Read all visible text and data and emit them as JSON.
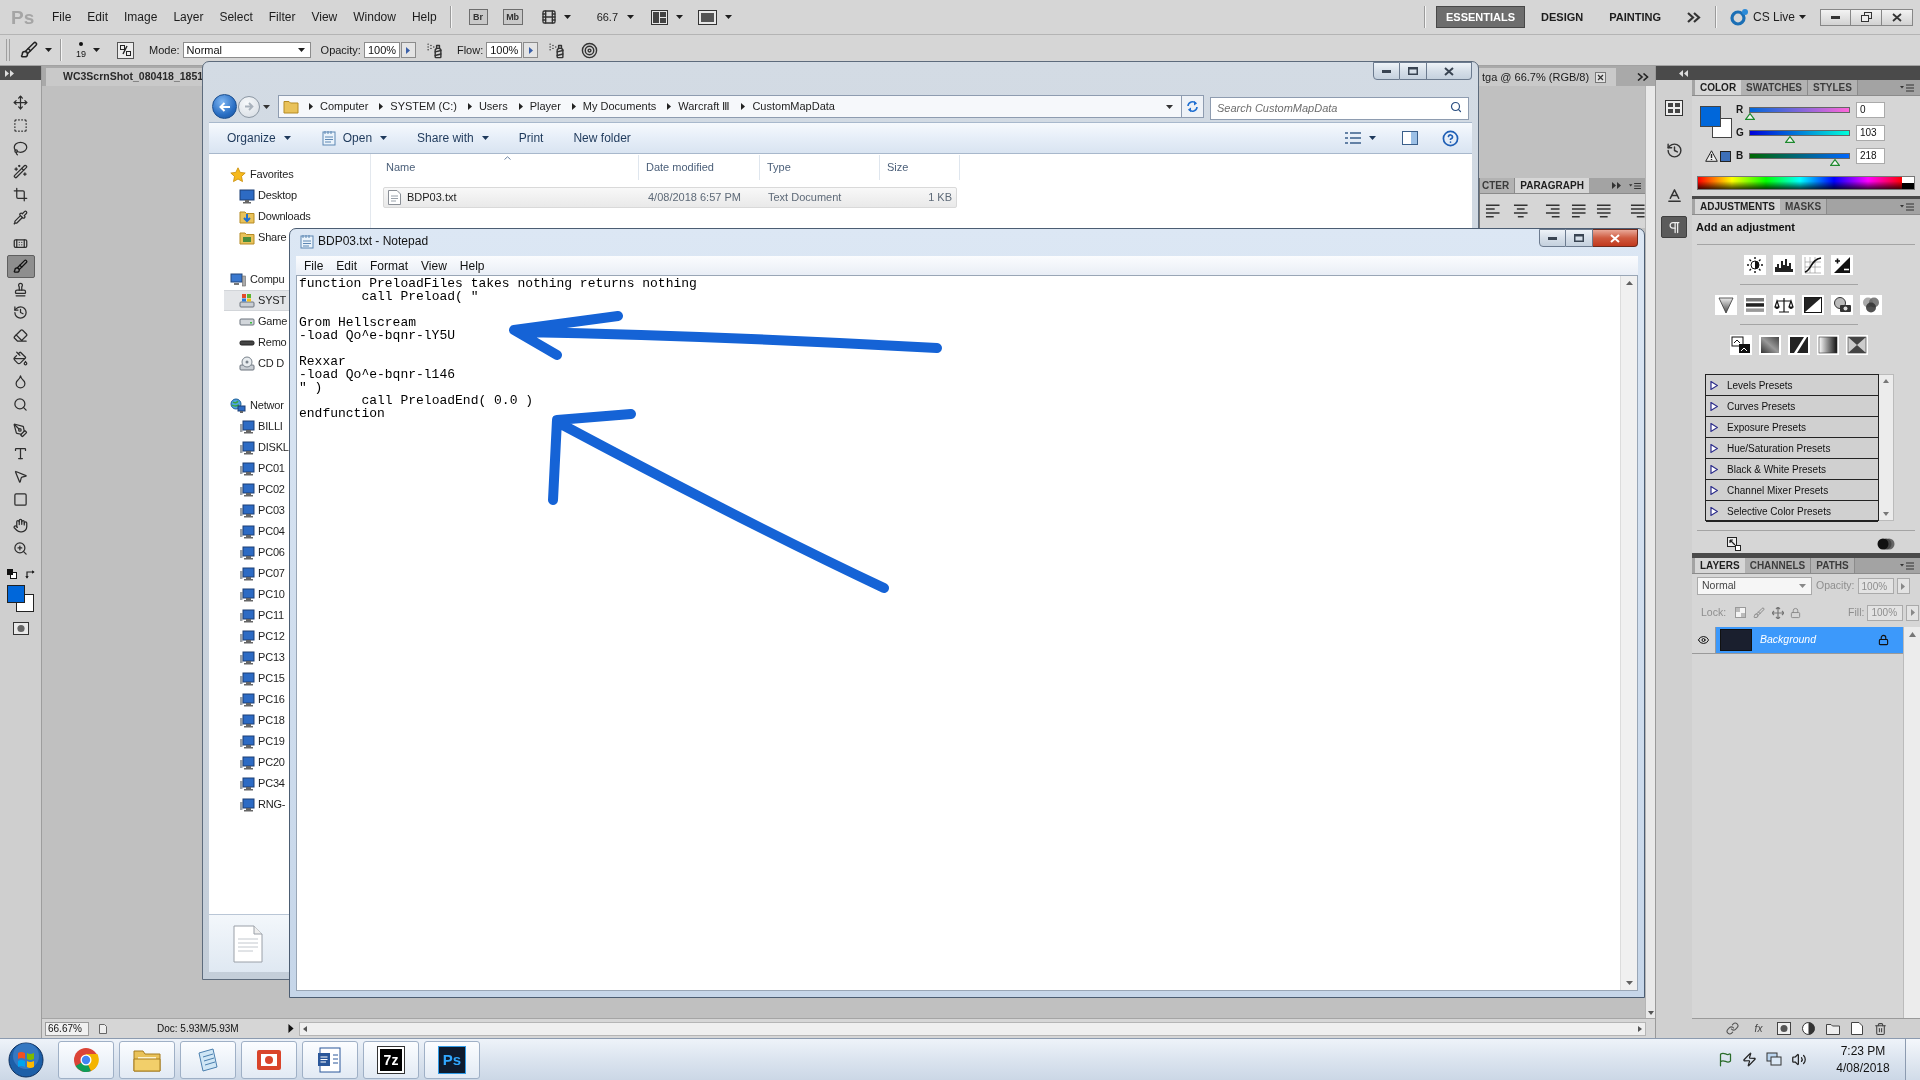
{
  "photoshop": {
    "logo": "Ps",
    "menu": [
      "File",
      "Edit",
      "Image",
      "Layer",
      "Select",
      "Filter",
      "View",
      "Window",
      "Help"
    ],
    "bridge": "Br",
    "mini_bridge": "Mb",
    "zoom": "66.7",
    "workspaces": [
      {
        "label": "ESSENTIALS",
        "selected": true
      },
      {
        "label": "DESIGN",
        "selected": false
      },
      {
        "label": "PAINTING",
        "selected": false
      }
    ],
    "cs_live": "CS Live"
  },
  "options_bar": {
    "brush_size": "19",
    "mode_label": "Mode:",
    "mode": "Normal",
    "opacity_label": "Opacity:",
    "opacity": "100%",
    "flow_label": "Flow:",
    "flow": "100%"
  },
  "tools": [
    {
      "kind": "move",
      "selected": false
    },
    {
      "kind": "marquee",
      "selected": false
    },
    {
      "kind": "lasso",
      "selected": false
    },
    {
      "kind": "quick-select",
      "selected": false
    },
    {
      "kind": "crop",
      "selected": false
    },
    {
      "kind": "eyedropper",
      "selected": false
    },
    {
      "kind": "healing",
      "selected": false
    },
    {
      "kind": "brush",
      "selected": true
    },
    {
      "kind": "stamp",
      "selected": false
    },
    {
      "kind": "history-brush",
      "selected": false
    },
    {
      "kind": "eraser",
      "selected": false
    },
    {
      "kind": "gradient",
      "selected": false
    },
    {
      "kind": "blur",
      "selected": false
    },
    {
      "kind": "dodge",
      "selected": false
    },
    {
      "kind": "pen",
      "selected": false
    },
    {
      "kind": "type",
      "selected": false
    },
    {
      "kind": "path-select",
      "selected": false
    },
    {
      "kind": "shape",
      "selected": false
    },
    {
      "kind": "hand",
      "selected": false
    },
    {
      "kind": "zoom",
      "selected": false
    }
  ],
  "document_tab": {
    "name": "WC3ScrnShot_080418_1851",
    "name_end": "tga @ 66.7% (RGB/8)"
  },
  "panel_icons": [
    {
      "kind": "mini-bridge",
      "selected": false
    },
    {
      "kind": "history",
      "selected": false
    },
    {
      "kind": "character",
      "selected": false
    },
    {
      "kind": "paragraph",
      "selected": true
    }
  ],
  "paragraph_panel": {
    "tabs": [
      {
        "label": "CTER",
        "selected": false
      },
      {
        "label": "PARAGRAPH",
        "selected": true
      }
    ]
  },
  "color_panel": {
    "tabs": [
      {
        "label": "COLOR",
        "selected": true
      },
      {
        "label": "SWATCHES",
        "selected": false
      },
      {
        "label": "STYLES",
        "selected": false
      }
    ],
    "channels": [
      {
        "name": "R",
        "value": "0",
        "level": 0
      },
      {
        "name": "G",
        "value": "103",
        "level": 0.404
      },
      {
        "name": "B",
        "value": "218",
        "level": 0.855
      }
    ]
  },
  "adjustments_panel": {
    "tabs": [
      {
        "label": "ADJUSTMENTS",
        "selected": true
      },
      {
        "label": "MASKS",
        "selected": false
      }
    ],
    "heading": "Add an adjustment",
    "presets": [
      {
        "label": "Levels Presets",
        "expanded": false
      },
      {
        "label": "Curves Presets",
        "expanded": false
      },
      {
        "label": "Exposure Presets",
        "expanded": false
      },
      {
        "label": "Hue/Saturation Presets",
        "expanded": false
      },
      {
        "label": "Black & White Presets",
        "expanded": false
      },
      {
        "label": "Channel Mixer Presets",
        "expanded": false
      },
      {
        "label": "Selective Color Presets",
        "expanded": false
      }
    ]
  },
  "layers_panel": {
    "tabs": [
      {
        "label": "LAYERS",
        "selected": true
      },
      {
        "label": "CHANNELS",
        "selected": false
      },
      {
        "label": "PATHS",
        "selected": false
      }
    ],
    "blend_mode": "Normal",
    "opacity": {
      "label": "Opacity:",
      "value": "100%",
      "disabled": true
    },
    "lock": {
      "label": "Lock:",
      "disabled": true
    },
    "fill": {
      "label": "Fill:",
      "value": "100%",
      "disabled": true
    },
    "layers": [
      {
        "name": "Background",
        "selected": true,
        "visible": true,
        "locked": true
      }
    ],
    "effects_button": "fx"
  },
  "status_bar": {
    "zoom": "66.67%",
    "doc_size": "Doc: 5.93M/5.93M"
  },
  "explorer": {
    "active": false,
    "breadcrumb": [
      "Computer",
      "SYSTEM (C:)",
      "Users",
      "Player",
      "My Documents",
      "Warcraft Ⅲ",
      "CustomMapData"
    ],
    "search": {
      "placeholder": "Search CustomMapData"
    },
    "toolbar": [
      {
        "label": "Organize",
        "menu": true
      },
      {
        "label": "Open",
        "menu": true
      },
      {
        "label": "Share with",
        "menu": true
      },
      {
        "label": "Print",
        "menu": false
      },
      {
        "label": "New folder",
        "menu": false
      }
    ],
    "sidebar": [
      {
        "label": "Favorites",
        "kind": "star",
        "selected": false,
        "children": [
          {
            "label": "Desktop",
            "kind": "desktop",
            "selected": false
          },
          {
            "label": "Downloads",
            "kind": "downloads",
            "selected": false
          },
          {
            "label": "Share",
            "kind": "folder",
            "selected": false
          }
        ]
      },
      {
        "label": "Compu",
        "kind": "computer",
        "selected": false,
        "children": [
          {
            "label": "SYST",
            "kind": "system-drive",
            "selected": true
          },
          {
            "label": "Game",
            "kind": "drive",
            "selected": false
          },
          {
            "label": "Remo",
            "kind": "removable",
            "selected": false
          },
          {
            "label": "CD D",
            "kind": "cd",
            "selected": false
          }
        ]
      },
      {
        "label": "Networ",
        "kind": "network",
        "selected": false,
        "children": [
          {
            "label": "BILLI",
            "kind": "pc",
            "selected": false
          },
          {
            "label": "DISKL",
            "kind": "pc",
            "selected": false
          },
          {
            "label": "PC01",
            "kind": "pc",
            "selected": false
          },
          {
            "label": "PC02",
            "kind": "pc",
            "selected": false
          },
          {
            "label": "PC03",
            "kind": "pc",
            "selected": false
          },
          {
            "label": "PC04",
            "kind": "pc",
            "selected": false
          },
          {
            "label": "PC06",
            "kind": "pc",
            "selected": false
          },
          {
            "label": "PC07",
            "kind": "pc",
            "selected": false
          },
          {
            "label": "PC10",
            "kind": "pc",
            "selected": false
          },
          {
            "label": "PC11",
            "kind": "pc",
            "selected": false
          },
          {
            "label": "PC12",
            "kind": "pc",
            "selected": false
          },
          {
            "label": "PC13",
            "kind": "pc",
            "selected": false
          },
          {
            "label": "PC15",
            "kind": "pc",
            "selected": false
          },
          {
            "label": "PC16",
            "kind": "pc",
            "selected": false
          },
          {
            "label": "PC18",
            "kind": "pc",
            "selected": false
          },
          {
            "label": "PC19",
            "kind": "pc",
            "selected": false
          },
          {
            "label": "PC20",
            "kind": "pc",
            "selected": false
          },
          {
            "label": "PC34",
            "kind": "pc",
            "selected": false
          },
          {
            "label": "RNG-",
            "kind": "pc",
            "selected": false
          }
        ]
      }
    ],
    "columns": [
      "Name",
      "Date modified",
      "Type",
      "Size"
    ],
    "files": [
      {
        "name": "BDP03.txt",
        "date_modified": "4/08/2018 6:57 PM",
        "type": "Text Document",
        "size": "1 KB",
        "selected": true
      }
    ]
  },
  "notepad": {
    "active": true,
    "title": "BDP03.txt - Notepad",
    "menu": [
      "File",
      "Edit",
      "Format",
      "View",
      "Help"
    ],
    "text": "function PreloadFiles takes nothing returns nothing\n\tcall Preload( \"\n\nGrom Hellscream\n-load Qo^e-bqnr-lY5U\n\nRexxar\n-load Qo^e-bqnr-l146\n\" )\n\tcall PreloadEnd( 0.0 )\nendfunction"
  },
  "taskbar": {
    "apps": [
      {
        "kind": "chrome"
      },
      {
        "kind": "folder"
      },
      {
        "kind": "notepad"
      },
      {
        "kind": "slides"
      },
      {
        "kind": "word"
      },
      {
        "kind": "archiver",
        "label": "7z"
      },
      {
        "kind": "photoshop",
        "label": "Ps"
      }
    ],
    "clock": {
      "time": "7:23 PM",
      "date": "4/08/2018"
    }
  }
}
